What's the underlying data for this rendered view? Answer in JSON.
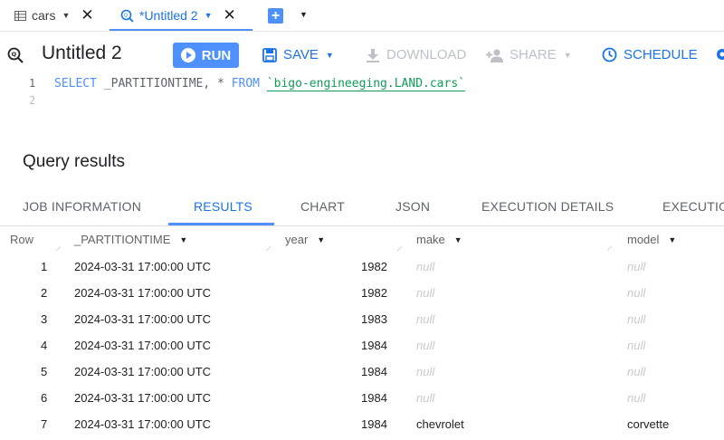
{
  "tabs": [
    {
      "label": "cars",
      "icon": "table-icon"
    },
    {
      "label": "*Untitled 2",
      "icon": "query-icon",
      "active": true
    }
  ],
  "toolbar": {
    "title": "Untitled 2",
    "run_label": "RUN",
    "save_label": "SAVE",
    "download_label": "DOWNLOAD",
    "share_label": "SHARE",
    "schedule_label": "SCHEDULE"
  },
  "editor": {
    "line_numbers": [
      "1",
      "2"
    ],
    "kw_select": "SELECT",
    "col_part": "_PARTITIONTIME,",
    "star": "*",
    "kw_from": "FROM",
    "table": "`bigo-engineeging.LAND.cars`"
  },
  "results": {
    "title": "Query results",
    "tabs": [
      "JOB INFORMATION",
      "RESULTS",
      "CHART",
      "JSON",
      "EXECUTION DETAILS",
      "EXECUTIO"
    ],
    "active_tab": "RESULTS",
    "columns": [
      "Row",
      "_PARTITIONTIME",
      "year",
      "make",
      "model"
    ],
    "rows": [
      {
        "row": "1",
        "partitiontime": "2024-03-31 17:00:00 UTC",
        "year": "1982",
        "make": "null",
        "model": "null"
      },
      {
        "row": "2",
        "partitiontime": "2024-03-31 17:00:00 UTC",
        "year": "1982",
        "make": "null",
        "model": "null"
      },
      {
        "row": "3",
        "partitiontime": "2024-03-31 17:00:00 UTC",
        "year": "1983",
        "make": "null",
        "model": "null"
      },
      {
        "row": "4",
        "partitiontime": "2024-03-31 17:00:00 UTC",
        "year": "1984",
        "make": "null",
        "model": "null"
      },
      {
        "row": "5",
        "partitiontime": "2024-03-31 17:00:00 UTC",
        "year": "1984",
        "make": "null",
        "model": "null"
      },
      {
        "row": "6",
        "partitiontime": "2024-03-31 17:00:00 UTC",
        "year": "1984",
        "make": "null",
        "model": "null"
      },
      {
        "row": "7",
        "partitiontime": "2024-03-31 17:00:00 UTC",
        "year": "1984",
        "make": "chevrolet",
        "model": "corvette"
      }
    ]
  },
  "colors": {
    "accent": "#1a73e8",
    "run_button": "#4d90fe",
    "string": "#0f9d58",
    "null_text": "#c9c9c9"
  }
}
